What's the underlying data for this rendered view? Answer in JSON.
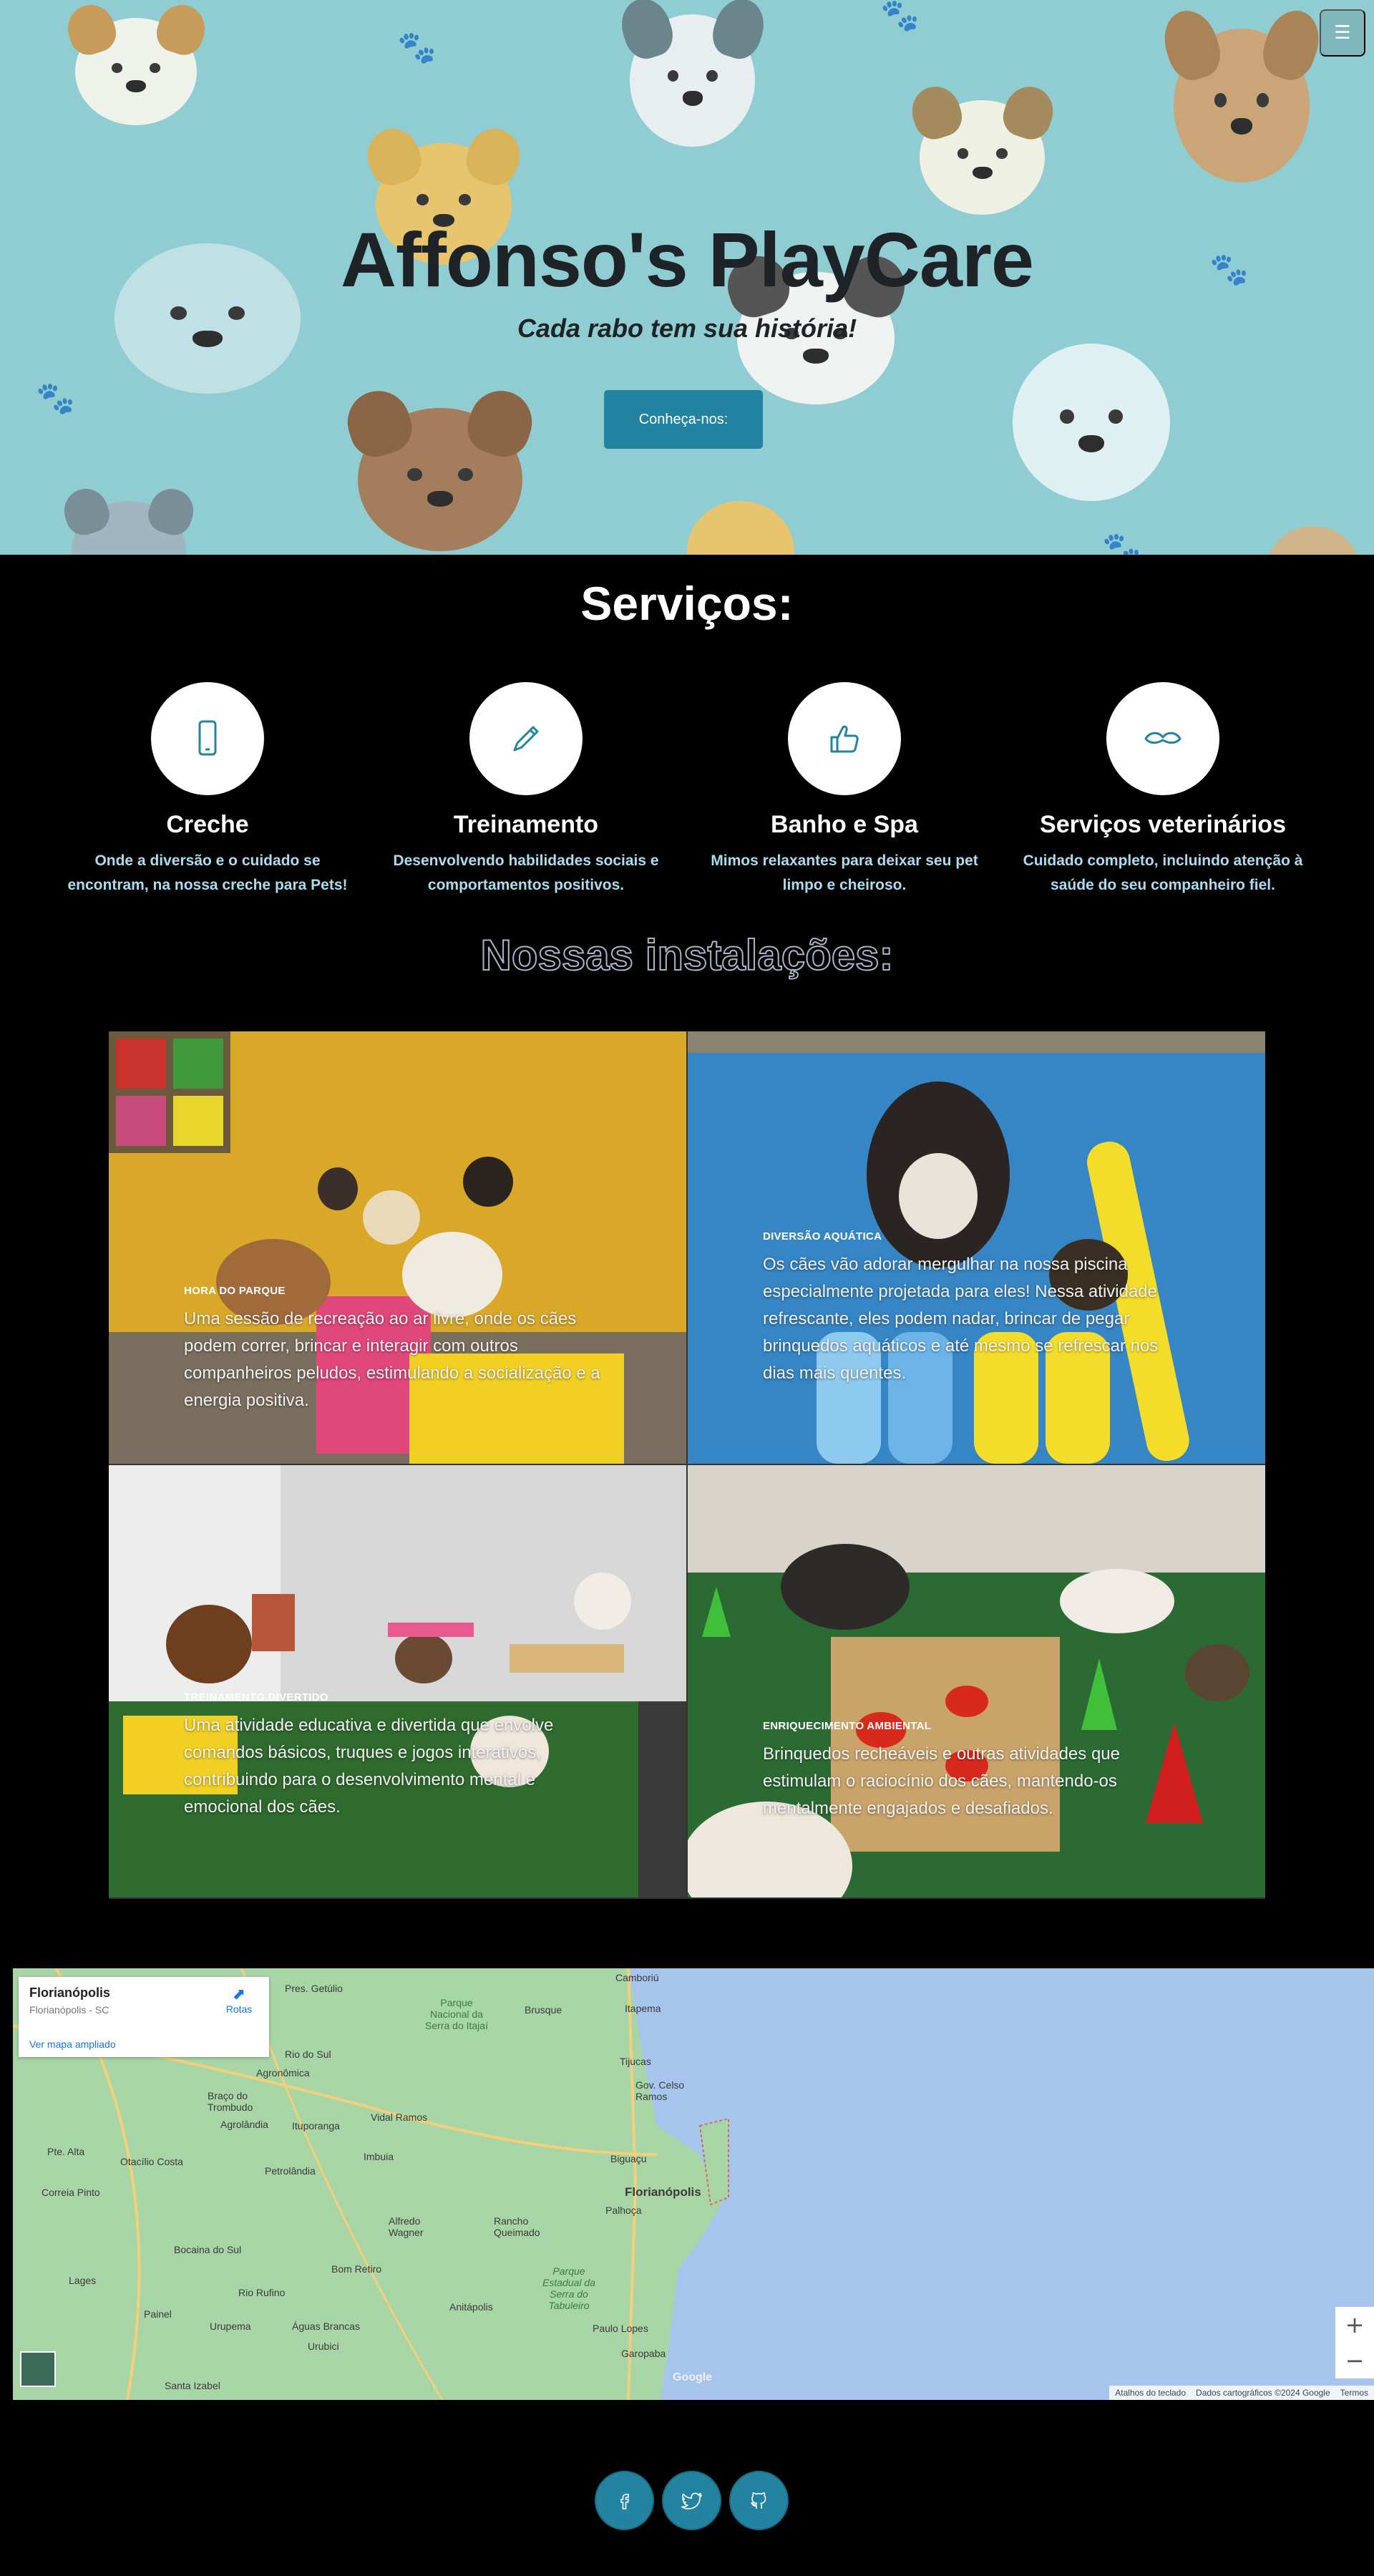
{
  "hero": {
    "title": "Affonso's PlayCare",
    "subtitle": "Cada rabo tem sua história!",
    "cta_label": "Conheça-nos:",
    "menu_icon": "hamburger-icon"
  },
  "services": {
    "title": "Serviços:",
    "items": [
      {
        "icon": "mobile-phone-icon",
        "title": "Creche",
        "text": "Onde a diversão e o cuidado se encontram, na nossa creche para Pets!"
      },
      {
        "icon": "pencil-icon",
        "title": "Treinamento",
        "text": "Desenvolvendo habilidades sociais e comportamentos positivos."
      },
      {
        "icon": "thumbs-up-icon",
        "title": "Banho e Spa",
        "text": "Mimos relaxantes para deixar seu pet limpo e cheiroso."
      },
      {
        "icon": "mustache-icon",
        "title": "Serviços veterinários",
        "text": "Cuidado completo, incluindo atenção à saúde do seu companheiro fiel."
      }
    ]
  },
  "facilities": {
    "title": "Nossas instalações:",
    "items": [
      {
        "title": "HORA DO PARQUE",
        "text": "Uma sessão de recreação ao ar livre, onde os cães podem correr, brincar e interagir com outros companheiros peludos, estimulando a socialização e a energia positiva."
      },
      {
        "title": "DIVERSÃO AQUÁTICA",
        "text": "Os cães vão adorar mergulhar na nossa piscina especialmente projetada para eles! Nessa atividade refrescante, eles podem nadar, brincar de pegar brinquedos aquáticos e até mesmo se refrescar nos dias mais quentes."
      },
      {
        "title": "TREINAMENTO DIVERTIDO",
        "text": "Uma atividade educativa e divertida que envolve comandos básicos, truques e jogos interativos, contribuindo para o desenvolvimento mental e emocional dos cães."
      },
      {
        "title": "ENRIQUECIMENTO AMBIENTAL",
        "text": "Brinquedos recheáveis e outras atividades que estimulam o raciocínio dos cães, mantendo-os mentalmente engajados e desafiados."
      }
    ]
  },
  "map": {
    "place_title": "Florianópolis",
    "place_subtitle": "Florianópolis - SC",
    "larger_map_link": "Ver mapa ampliado",
    "directions_label": "Rotas",
    "zoom_in": "+",
    "zoom_out": "−",
    "google_logo": "Google",
    "footer": {
      "shortcuts": "Atalhos do teclado",
      "map_data": "Dados cartográficos ©2024 Google",
      "terms": "Termos"
    },
    "cities": [
      "Pres. Getúlio",
      "Brusque",
      "Camboriú",
      "Itapema",
      "Tijucas",
      "Gov. Celso Ramos",
      "Rio do Sul",
      "Agronômica",
      "Braço do Trombudo",
      "Agrolândia",
      "Ituporanga",
      "Vidal Ramos",
      "Biguaçu",
      "Florianópolis",
      "Palhoça",
      "Pte. Alta",
      "Otacílio Costa",
      "Imbuia",
      "Petrolândia",
      "Correia Pinto",
      "Alfredo Wagner",
      "Rancho Queimado",
      "Bocaina do Sul",
      "Bom Retiro",
      "Rio Rufino",
      "Lages",
      "Painel",
      "Urubici",
      "Urupema",
      "Águas Brancas",
      "Anitápolis",
      "Paulo Lopes",
      "Garopaba",
      "Santa Izabel",
      "Parque Nacional da Serra do Itajaí",
      "Parque Estadual da Serra do Tabuleiro"
    ]
  },
  "social": [
    {
      "icon": "facebook-icon",
      "label": "f"
    },
    {
      "icon": "twitter-icon",
      "label": ""
    },
    {
      "icon": "github-icon",
      "label": ""
    }
  ]
}
